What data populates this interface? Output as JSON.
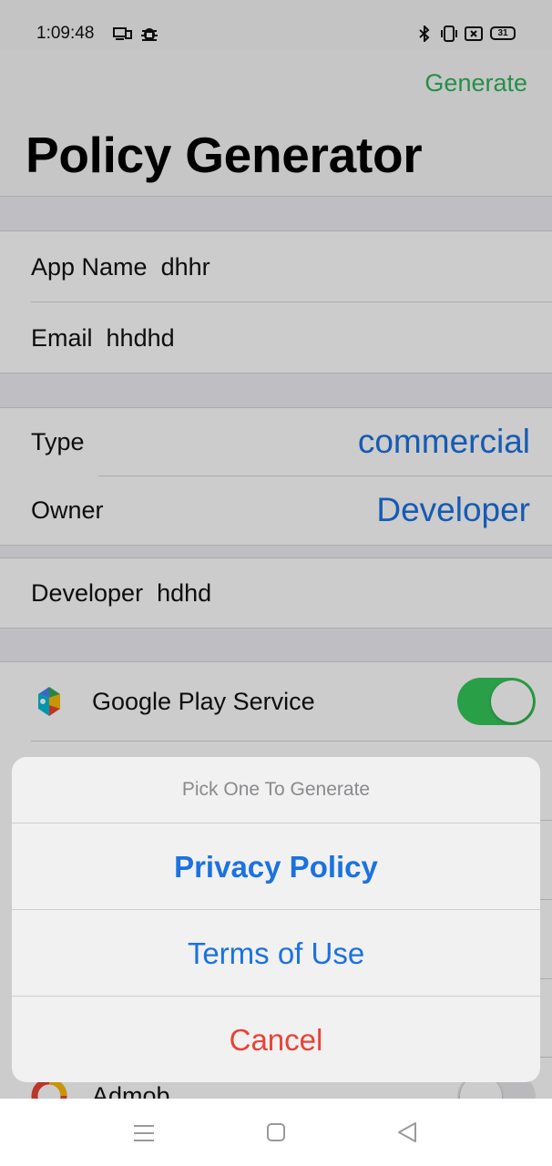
{
  "status_bar": {
    "time": "1:09:48",
    "battery": "31"
  },
  "header": {
    "generate_label": "Generate",
    "title": "Policy Generator"
  },
  "form": {
    "app_name_label": "App Name",
    "app_name_value": "dhhr",
    "email_label": "Email",
    "email_value": "hhdhd",
    "type_label": "Type",
    "type_value": "commercial",
    "owner_label": "Owner",
    "owner_value": "Developer",
    "developer_label": "Developer",
    "developer_value": "hdhd"
  },
  "services": [
    {
      "label": "Google Play Service",
      "icon": "google-play-services-icon",
      "enabled": true
    },
    {
      "label": "Admob",
      "icon": "admob-icon",
      "enabled": false
    }
  ],
  "action_sheet": {
    "title": "Pick One To Generate",
    "options": [
      "Privacy Policy",
      "Terms of Use"
    ],
    "cancel": "Cancel"
  },
  "colors": {
    "accent_blue": "#1b72e0",
    "generate_green": "#2fb35a",
    "cancel_red": "#e84335",
    "toggle_on": "#34c759"
  }
}
